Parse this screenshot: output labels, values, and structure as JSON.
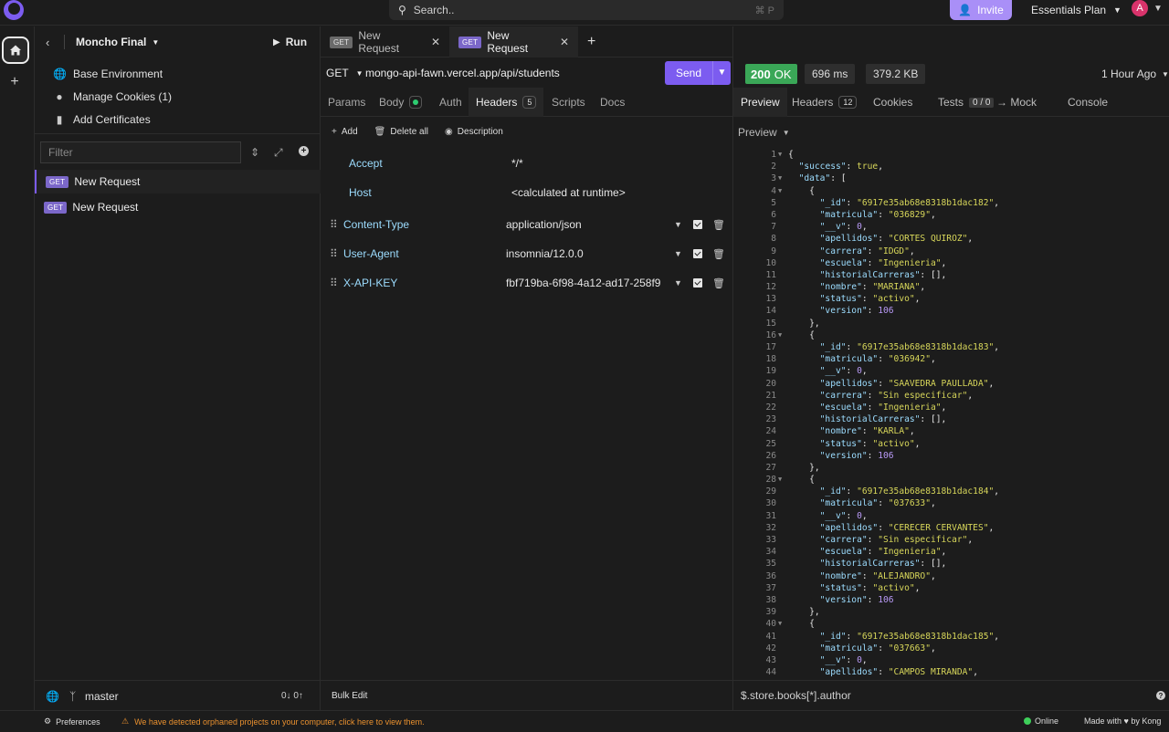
{
  "topbar": {
    "search_placeholder": "Search..",
    "search_shortcut": "⌘ P",
    "invite_label": "Invite",
    "plan_label": "Essentials Plan",
    "avatar_initial": "A"
  },
  "sidebar": {
    "project_name": "Moncho Final",
    "run_label": "Run",
    "links": [
      {
        "label": "Base Environment"
      },
      {
        "label": "Manage Cookies (1)"
      },
      {
        "label": "Add Certificates"
      }
    ],
    "filter_placeholder": "Filter",
    "requests": [
      {
        "method": "GET",
        "name": "New Request"
      },
      {
        "method": "GET",
        "name": "New Request"
      }
    ],
    "branch": "master",
    "sync": "0↓ 0↑"
  },
  "request": {
    "tabs": [
      {
        "method": "GET",
        "name": "New Request",
        "close": "✕"
      },
      {
        "method": "GET",
        "name": "New Request",
        "close": "✕"
      }
    ],
    "new_tab": "+",
    "method": "GET",
    "url": "mongo-api-fawn.vercel.app/api/students",
    "send_label": "Send",
    "subtabs": {
      "params": "Params",
      "body": "Body",
      "auth": "Auth",
      "headers": "Headers",
      "headers_count": "5",
      "scripts": "Scripts",
      "docs": "Docs"
    },
    "actions": {
      "add": "Add",
      "delete_all": "Delete all",
      "description": "Description"
    },
    "headers": [
      {
        "key": "Accept",
        "value": "*/*"
      },
      {
        "key": "Host",
        "value": "<calculated at runtime>"
      },
      {
        "key": "Content-Type",
        "value": "application/json"
      },
      {
        "key": "User-Agent",
        "value": "insomnia/12.0.0"
      },
      {
        "key": "X-API-KEY",
        "value": "fbf719ba-6f98-4a12-ad17-258f9"
      }
    ],
    "bulk_edit": "Bulk Edit"
  },
  "response": {
    "status_code": "200",
    "status_text": "OK",
    "time": "696 ms",
    "size": "379.2 KB",
    "ago": "1 Hour Ago",
    "tabs": {
      "preview": "Preview",
      "headers": "Headers",
      "headers_count": "12",
      "cookies": "Cookies",
      "tests": "Tests",
      "tests_count": "0 / 0",
      "mock": "→ Mock",
      "console": "Console"
    },
    "preview_mode": "Preview",
    "filter_query": "$.store.books[*].author",
    "code_lines": [
      "{",
      "  \"success\": true,",
      "  \"data\": [",
      "    {",
      "      \"_id\": \"6917e35ab68e8318b1dac182\",",
      "      \"matricula\": \"036829\",",
      "      \"__v\": 0,",
      "      \"apellidos\": \"CORTES QUIROZ\",",
      "      \"carrera\": \"IDGD\",",
      "      \"escuela\": \"Ingenieria\",",
      "      \"historialCarreras\": [],",
      "      \"nombre\": \"MARIANA\",",
      "      \"status\": \"activo\",",
      "      \"version\": 106",
      "    },",
      "    {",
      "      \"_id\": \"6917e35ab68e8318b1dac183\",",
      "      \"matricula\": \"036942\",",
      "      \"__v\": 0,",
      "      \"apellidos\": \"SAAVEDRA PAULLADA\",",
      "      \"carrera\": \"Sin especificar\",",
      "      \"escuela\": \"Ingenieria\",",
      "      \"historialCarreras\": [],",
      "      \"nombre\": \"KARLA\",",
      "      \"status\": \"activo\",",
      "      \"version\": 106",
      "    },",
      "    {",
      "      \"_id\": \"6917e35ab68e8318b1dac184\",",
      "      \"matricula\": \"037633\",",
      "      \"__v\": 0,",
      "      \"apellidos\": \"CERECER CERVANTES\",",
      "      \"carrera\": \"Sin especificar\",",
      "      \"escuela\": \"Ingenieria\",",
      "      \"historialCarreras\": [],",
      "      \"nombre\": \"ALEJANDRO\",",
      "      \"status\": \"activo\",",
      "      \"version\": 106",
      "    },",
      "    {",
      "      \"_id\": \"6917e35ab68e8318b1dac185\",",
      "      \"matricula\": \"037663\",",
      "      \"__v\": 0,",
      "      \"apellidos\": \"CAMPOS MIRANDA\","
    ],
    "foldable_lines": [
      1,
      3,
      4,
      16,
      28,
      40
    ]
  },
  "footer": {
    "preferences": "Preferences",
    "warning": "We have detected orphaned projects on your computer, click here to view them.",
    "status": "Online",
    "made_with": "Made with ♥ by Kong"
  },
  "colors": {
    "accent": "#7c5cf0",
    "status_ok": "#3aa757",
    "warning": "#e9902e",
    "online": "#3ecf5a"
  }
}
